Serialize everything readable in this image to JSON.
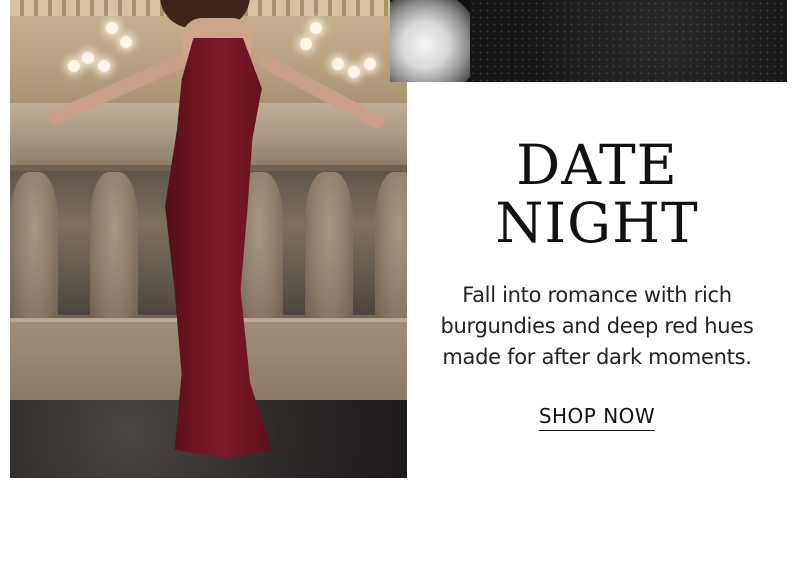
{
  "promo": {
    "title_line1": "DATE",
    "title_line2": "NIGHT",
    "description": "Fall into romance with rich burgundies and deep red hues made for after dark moments.",
    "cta_label": "SHOP NOW"
  },
  "colors": {
    "background": "#ffffff",
    "text": "#111111",
    "dress_accent": "#6e1423"
  }
}
